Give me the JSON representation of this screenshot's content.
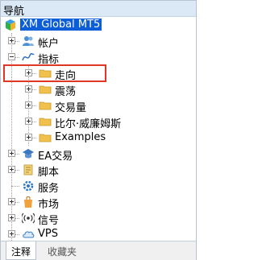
{
  "panel": {
    "title": "导航"
  },
  "tree": {
    "root": "XM Global MT5",
    "accounts": "帐户",
    "indicators": "指标",
    "indicator_children": [
      "走向",
      "震荡",
      "交易量",
      "比尔·威廉姆斯",
      "Examples"
    ],
    "ea": "EA交易",
    "scripts": "脚本",
    "services": "服务",
    "market": "市场",
    "signals": "信号",
    "vps": "VPS"
  },
  "tabs": [
    "注释",
    "收藏夹"
  ],
  "colors": {
    "selection": "#0b5ed7",
    "highlight_box": "#e03626",
    "folder": "#f2c14b"
  }
}
